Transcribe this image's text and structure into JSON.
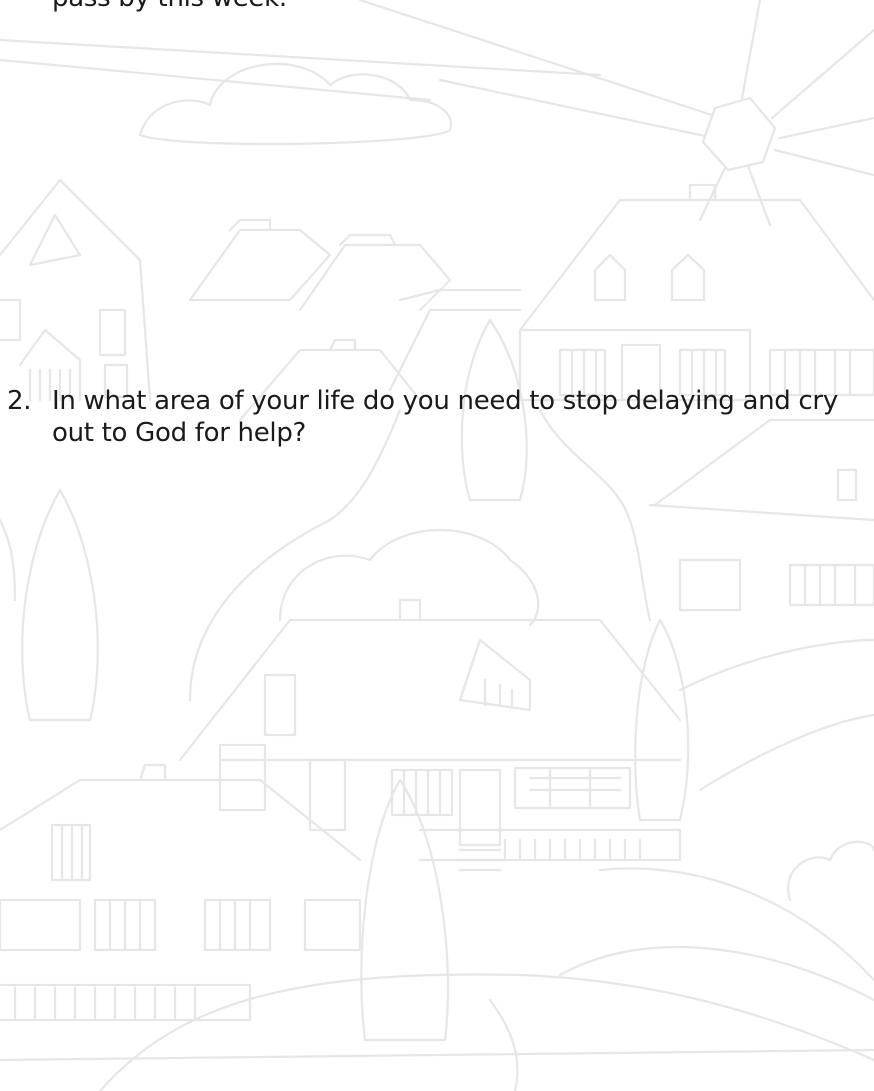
{
  "worksheet": {
    "previous_item_tail": "pass by this week.",
    "questions": [
      {
        "number": "2.",
        "lines": [
          "In what area of your life do you need to stop delaying and cry",
          "out to God for help?"
        ]
      }
    ]
  },
  "colors": {
    "text": "#1a1a1a",
    "illustration_line": "#e6e6e6",
    "background": "#ffffff"
  }
}
